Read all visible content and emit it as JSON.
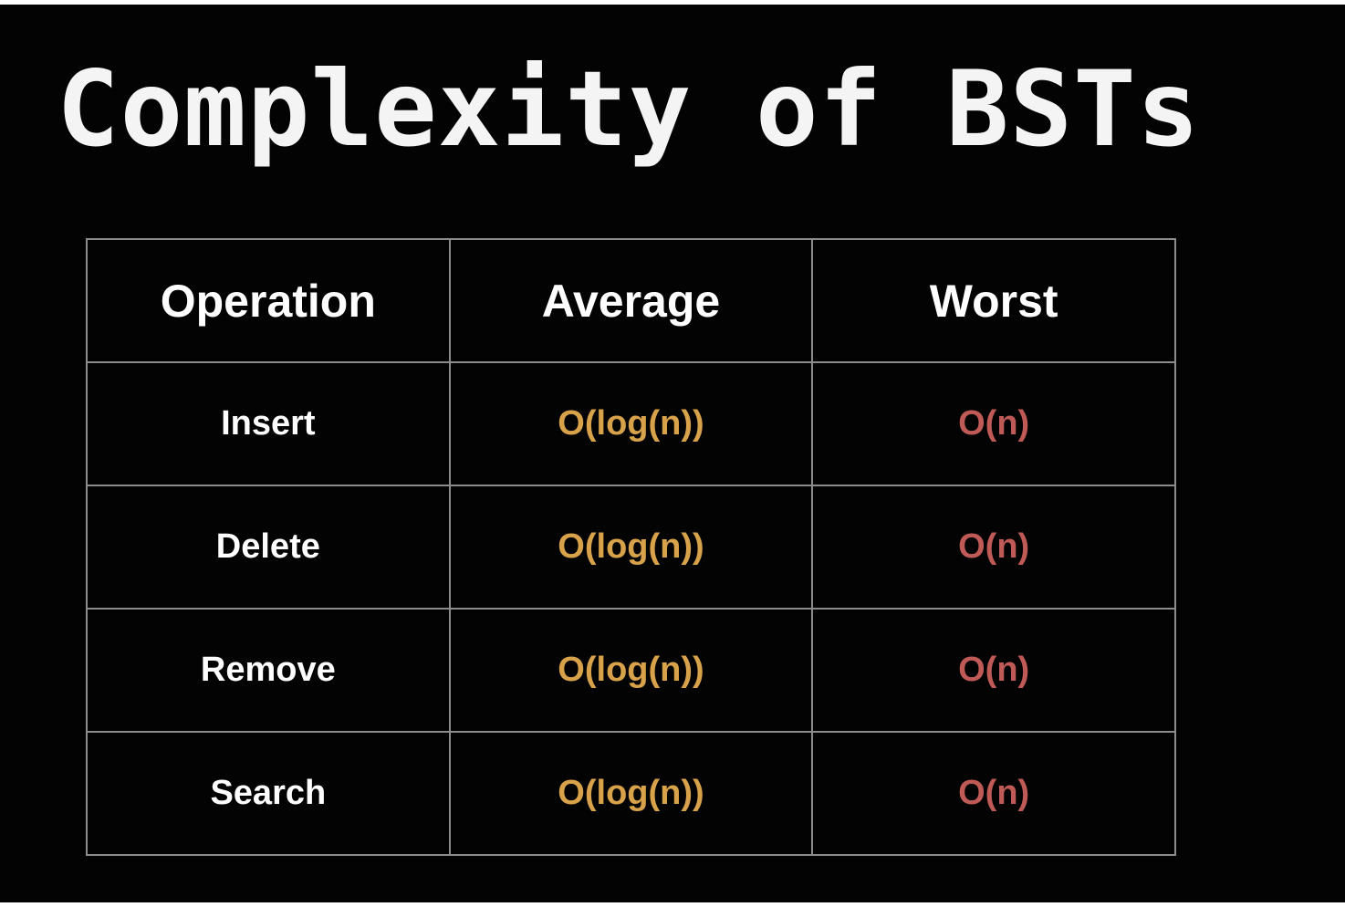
{
  "slide": {
    "title": "Complexity of BSTs"
  },
  "colors": {
    "background": "#030303",
    "average": "#d8a24a",
    "worst": "#c05a57",
    "grid": "#8c8c8c"
  },
  "table": {
    "headers": [
      "Operation",
      "Average",
      "Worst"
    ],
    "rows": [
      {
        "operation": "Insert",
        "average": "O(log(n))",
        "worst": "O(n)"
      },
      {
        "operation": "Delete",
        "average": "O(log(n))",
        "worst": "O(n)"
      },
      {
        "operation": "Remove",
        "average": "O(log(n))",
        "worst": "O(n)"
      },
      {
        "operation": "Search",
        "average": "O(log(n))",
        "worst": "O(n)"
      }
    ]
  }
}
